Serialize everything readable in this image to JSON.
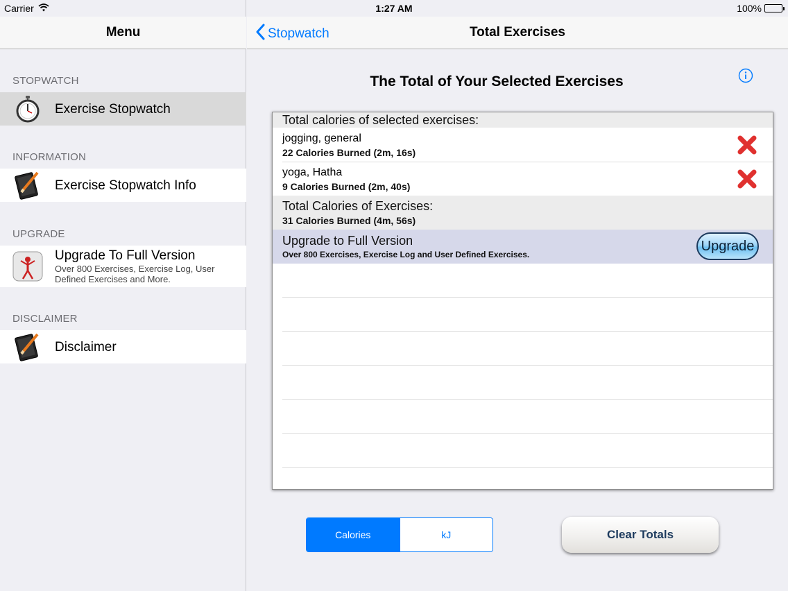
{
  "status_bar": {
    "carrier": "Carrier",
    "time": "1:27 AM",
    "battery": "100%"
  },
  "master": {
    "title": "Menu",
    "sections": [
      {
        "header": "STOPWATCH",
        "items": [
          {
            "label": "Exercise Stopwatch",
            "icon": "stopwatch-icon",
            "selected": true
          }
        ]
      },
      {
        "header": "INFORMATION",
        "items": [
          {
            "label": "Exercise Stopwatch Info",
            "icon": "book-pencil-icon"
          }
        ]
      },
      {
        "header": "UPGRADE",
        "items": [
          {
            "label": "Upgrade To Full Version",
            "subtitle": "Over 800 Exercises, Exercise Log, User Defined Exercises and More.",
            "icon": "app-icon"
          }
        ]
      },
      {
        "header": "DISCLAIMER",
        "items": [
          {
            "label": "Disclaimer",
            "icon": "book-pencil-icon"
          }
        ]
      }
    ]
  },
  "detail": {
    "back_label": "Stopwatch",
    "title": "Total Exercises",
    "heading": "The Total of Your Selected Exercises",
    "table": {
      "header": "Total calories of selected exercises:",
      "rows": [
        {
          "name": "jogging, general",
          "detail": "22 Calories Burned  (2m, 16s)"
        },
        {
          "name": "yoga, Hatha",
          "detail": "9 Calories Burned  (2m, 40s)"
        }
      ],
      "total": {
        "name": "Total Calories of Exercises:",
        "detail": "31 Calories Burned    (4m, 56s)"
      },
      "upgrade": {
        "name": "Upgrade to Full Version",
        "detail": "Over 800 Exercises, Exercise Log and User Defined Exercises.",
        "button": "Upgrade"
      }
    },
    "units": {
      "options": [
        "Calories",
        "kJ"
      ],
      "selected": "Calories"
    },
    "clear_button": "Clear Totals"
  },
  "colors": {
    "accent": "#007aff",
    "remove": "#e0312f"
  }
}
